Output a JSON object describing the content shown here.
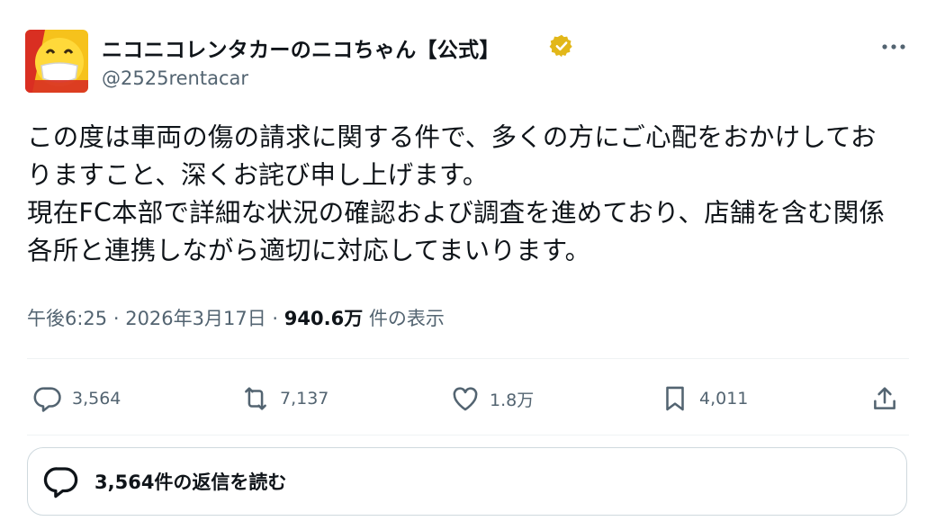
{
  "account": {
    "display_name": "ニコニコレンタカーのニコちゃん【公式】",
    "handle": "@2525rentacar",
    "avatar_icon": "smiling-mascot-avatar",
    "verified_color": "#e2b719"
  },
  "tweet": {
    "lines": [
      "この度は車両の傷の請求に関する件で、多くの方にご心配をおかけしてお",
      "りますこと、深くお詫び申し上げます。",
      "現在FC本部で詳細な状況の確認および調査を進めており、店舗を含む関係",
      "各所と連携しながら適切に対応してまいります。"
    ]
  },
  "meta": {
    "time": "午後6:25",
    "separator1": " · ",
    "date": "2026年3月17日",
    "separator2": " · ",
    "views_count": "940.6万",
    "views_label": " 件の表示"
  },
  "actions": {
    "reply_count": "3,564",
    "retweet_count": "7,137",
    "like_count": "1.8万",
    "bookmark_count": "4,011"
  },
  "read_replies": {
    "label": "3,564件の返信を読む"
  },
  "colors": {
    "text_primary": "#0f1419",
    "text_secondary": "#536471",
    "border": "#cfd9de"
  }
}
